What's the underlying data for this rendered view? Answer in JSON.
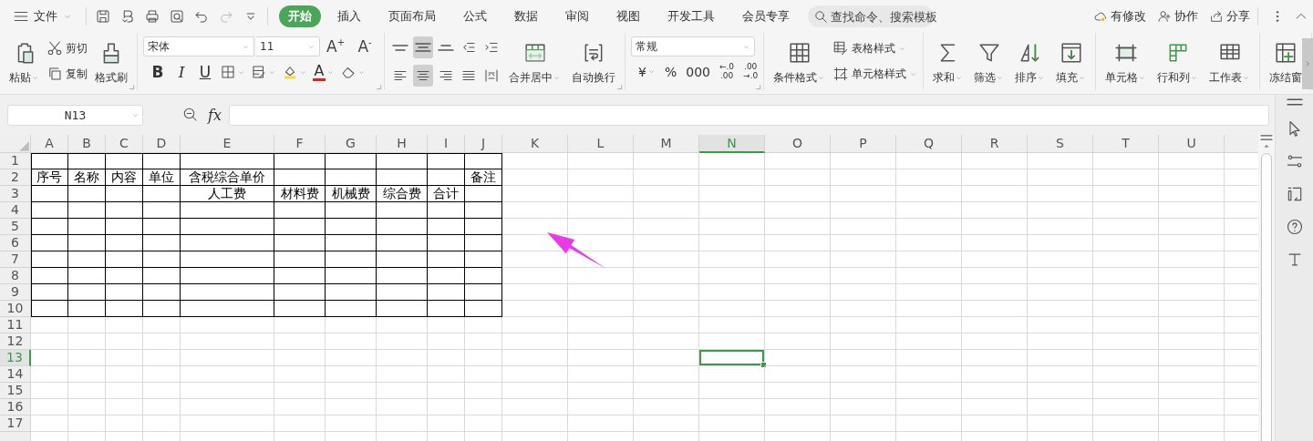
{
  "menu": {
    "label": "文件"
  },
  "quick_access": [
    {
      "kind": "save",
      "disabled": false
    },
    {
      "kind": "export",
      "disabled": false
    },
    {
      "kind": "print",
      "disabled": false
    },
    {
      "kind": "preview",
      "disabled": false
    },
    {
      "kind": "undo",
      "disabled": false
    },
    {
      "kind": "redo",
      "disabled": true
    },
    {
      "kind": "customize",
      "disabled": false
    }
  ],
  "tabs": [
    {
      "label": "开始",
      "selected": true
    },
    {
      "label": "插入",
      "selected": false
    },
    {
      "label": "页面布局",
      "selected": false
    },
    {
      "label": "公式",
      "selected": false
    },
    {
      "label": "数据",
      "selected": false
    },
    {
      "label": "审阅",
      "selected": false
    },
    {
      "label": "视图",
      "selected": false
    },
    {
      "label": "开发工具",
      "selected": false
    },
    {
      "label": "会员专享",
      "selected": false
    }
  ],
  "search": {
    "placeholder": "查找命令、搜索模板"
  },
  "header_actions": [
    {
      "kind": "cloud",
      "label": "有修改"
    },
    {
      "kind": "user",
      "label": "协作"
    },
    {
      "kind": "share",
      "label": "分享"
    }
  ],
  "window_controls": [
    {
      "kind": "more"
    },
    {
      "kind": "collapse"
    }
  ],
  "ribbon": {
    "groups": [
      {
        "kind": "buttons",
        "launcher": true,
        "items": [
          {
            "kind": "paste",
            "label": "粘贴",
            "dropdown": true
          },
          {
            "kind": "stack",
            "items": [
              {
                "kind": "cut",
                "label": "剪切"
              },
              {
                "kind": "copy",
                "label": "复制"
              }
            ]
          },
          {
            "kind": "painter",
            "label": "格式刷"
          }
        ]
      },
      {
        "kind": "font",
        "launcher": true,
        "font_name": "宋体",
        "font_size": "11",
        "size_buttons": [
          "A$^{+}$",
          "A$^{-}$"
        ],
        "style_buttons": [
          {
            "kind": "bold",
            "label": "B"
          },
          {
            "kind": "italic",
            "label": "I"
          },
          {
            "kind": "underline",
            "label": "U"
          }
        ],
        "tools": [
          {
            "kind": "borders",
            "dropdown": true
          },
          {
            "kind": "pattern",
            "dropdown": true
          },
          {
            "kind": "highlight",
            "dropdown": true
          },
          {
            "kind": "font-color",
            "label": "A",
            "dropdown": true
          },
          {
            "kind": "eraser",
            "dropdown": true
          }
        ]
      },
      {
        "kind": "alignment",
        "launcher": true,
        "rows": [
          [
            {
              "kind": "align-top",
              "selected": false
            },
            {
              "kind": "align-middle",
              "selected": true
            },
            {
              "kind": "align-bottom",
              "selected": false
            },
            {
              "kind": "indent-less",
              "selected": false
            },
            {
              "kind": "indent-more",
              "selected": false
            }
          ],
          [
            {
              "kind": "align-left",
              "selected": false
            },
            {
              "kind": "align-center",
              "selected": true
            },
            {
              "kind": "align-right",
              "selected": false
            },
            {
              "kind": "justify",
              "selected": false
            },
            {
              "kind": "distributed",
              "selected": false
            }
          ]
        ],
        "buttons": [
          {
            "kind": "merge",
            "label": "合并居中",
            "dropdown": true
          },
          {
            "kind": "wrap",
            "label": "自动换行"
          }
        ]
      },
      {
        "kind": "number",
        "launcher": true,
        "format": "常规",
        "tools": [
          {
            "kind": "currency",
            "lines": [
              "¥"
            ],
            "dropdown": true
          },
          {
            "kind": "percent",
            "lines": [
              "%"
            ]
          },
          {
            "kind": "thousands",
            "lines": [
              "000"
            ]
          },
          {
            "kind": "add-decimal",
            "lines": [
              "←.0",
              ".00"
            ]
          },
          {
            "kind": "remove-decimal",
            "lines": [
              ".00",
              "→.0"
            ]
          }
        ]
      },
      {
        "kind": "buttons",
        "items": [
          {
            "kind": "cond-format",
            "label": "条件格式",
            "dropdown": true
          },
          {
            "kind": "stack",
            "items": [
              {
                "kind": "table-style",
                "label": "表格样式",
                "dropdown": true
              },
              {
                "kind": "cell-style",
                "label": "单元格样式",
                "dropdown": true
              }
            ]
          }
        ]
      },
      {
        "kind": "buttons",
        "items": [
          {
            "kind": "sum",
            "label": "求和",
            "dropdown": true
          },
          {
            "kind": "filter",
            "label": "筛选",
            "dropdown": true
          },
          {
            "kind": "sort",
            "label": "排序",
            "dropdown": true
          },
          {
            "kind": "fill",
            "label": "填充",
            "dropdown": true
          }
        ]
      },
      {
        "kind": "buttons",
        "items": [
          {
            "kind": "cells",
            "label": "单元格",
            "dropdown": true
          },
          {
            "kind": "rows-cols",
            "label": "行和列",
            "dropdown": true
          },
          {
            "kind": "sheet",
            "label": "工作表",
            "dropdown": true
          }
        ]
      },
      {
        "kind": "buttons",
        "items": [
          {
            "kind": "freeze",
            "label": "冻结窗"
          }
        ]
      }
    ]
  },
  "formula_bar": {
    "name_box": "N13",
    "function_label": "fx"
  },
  "sheet": {
    "columns": [
      {
        "label": "A",
        "selected": false
      },
      {
        "label": "B",
        "selected": false
      },
      {
        "label": "C",
        "selected": false
      },
      {
        "label": "D",
        "selected": false
      },
      {
        "label": "E",
        "selected": false
      },
      {
        "label": "F",
        "selected": false
      },
      {
        "label": "G",
        "selected": false
      },
      {
        "label": "H",
        "selected": false
      },
      {
        "label": "I",
        "selected": false
      },
      {
        "label": "J",
        "selected": false
      },
      {
        "label": "K",
        "selected": false
      },
      {
        "label": "L",
        "selected": false
      },
      {
        "label": "M",
        "selected": false
      },
      {
        "label": "N",
        "selected": true
      },
      {
        "label": "O",
        "selected": false
      },
      {
        "label": "P",
        "selected": false
      },
      {
        "label": "Q",
        "selected": false
      },
      {
        "label": "R",
        "selected": false
      },
      {
        "label": "S",
        "selected": false
      },
      {
        "label": "T",
        "selected": false
      },
      {
        "label": "U",
        "selected": false
      }
    ],
    "rows": [
      {
        "label": "1",
        "selected": false,
        "bordered": true
      },
      {
        "label": "2",
        "selected": false,
        "bordered": true,
        "cells": [
          "序号",
          "名称",
          "内容",
          "单位",
          "含税综合单价",
          null,
          null,
          null,
          null,
          "备注"
        ]
      },
      {
        "label": "3",
        "selected": false,
        "bordered": true,
        "cells": [
          null,
          null,
          null,
          null,
          "人工费",
          "材料费",
          "机械费",
          "综合费",
          "合计",
          null
        ]
      },
      {
        "label": "4",
        "selected": false,
        "bordered": true
      },
      {
        "label": "5",
        "selected": false,
        "bordered": true
      },
      {
        "label": "6",
        "selected": false,
        "bordered": true
      },
      {
        "label": "7",
        "selected": false,
        "bordered": true
      },
      {
        "label": "8",
        "selected": false,
        "bordered": true
      },
      {
        "label": "9",
        "selected": false,
        "bordered": true
      },
      {
        "label": "10",
        "selected": false,
        "bordered": true
      },
      {
        "label": "11",
        "selected": false,
        "bordered": false
      },
      {
        "label": "12",
        "selected": false,
        "bordered": false
      },
      {
        "label": "13",
        "selected": true,
        "bordered": false
      },
      {
        "label": "14",
        "selected": false,
        "bordered": false
      },
      {
        "label": "15",
        "selected": false,
        "bordered": false
      },
      {
        "label": "16",
        "selected": false,
        "bordered": false
      },
      {
        "label": "17",
        "selected": false,
        "bordered": false
      }
    ]
  },
  "annotations": [
    {
      "kind": "arrow"
    }
  ]
}
